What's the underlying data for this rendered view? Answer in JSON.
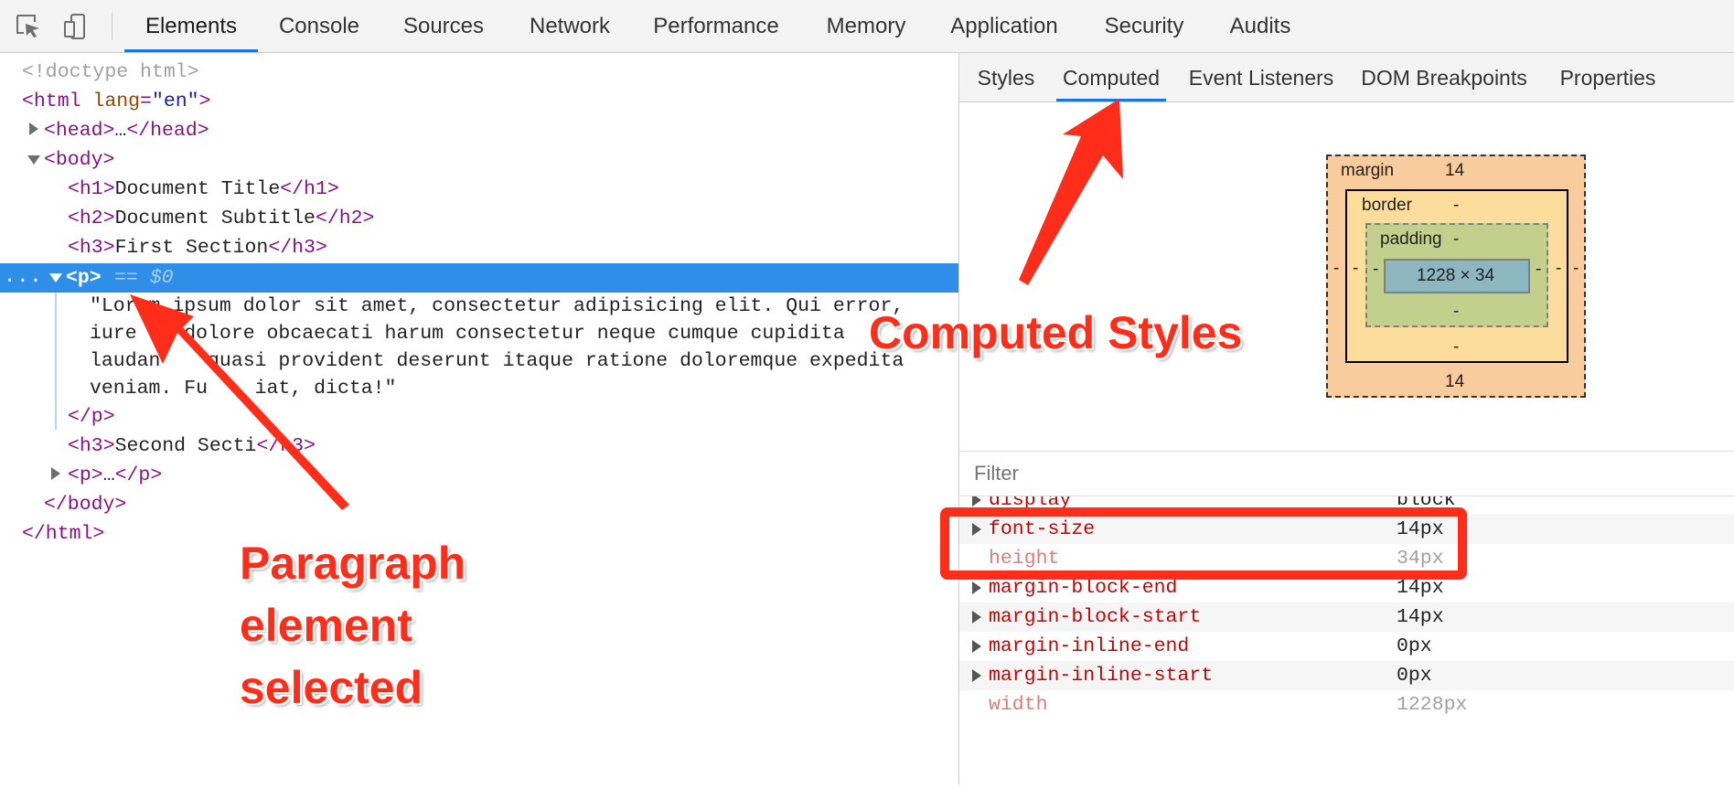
{
  "toolbar": {
    "icons": [
      "inspect-element-icon",
      "device-toolbar-icon"
    ],
    "tabs": [
      "Elements",
      "Console",
      "Sources",
      "Network",
      "Performance",
      "Memory",
      "Application",
      "Security",
      "Audits"
    ],
    "active_tab": "Elements"
  },
  "elements": {
    "doctype": "<!doctype html>",
    "html_open": "<html",
    "html_attr_name": "lang",
    "html_attr_value": "\"en\"",
    "head_tag_open": "<head>",
    "ellipsis": "…",
    "head_tag_close": "</head>",
    "body_open": "<body>",
    "h1_open": "<h1>",
    "h1_text": "Document Title",
    "h1_close": "</h1>",
    "h2_open": "<h2>",
    "h2_text": "Document Subtitle",
    "h2_close": "</h2>",
    "h3_open": "<h3>",
    "h3a_text": "First Section",
    "h3_close": "</h3>",
    "selected_dots": "...",
    "selected_tag": "<p>",
    "selected_marker": "== $0",
    "para_lines": [
      "\"Lorem ipsum dolor sit amet, consectetur adipisicing elit. Qui error,",
      "iure    dolore obcaecati harum consectetur neque cumque cupidita",
      "laudan    quasi provident deserunt itaque ratione doloremque expedita",
      "veniam. Fu    iat, dicta!\""
    ],
    "p_close": "</p>",
    "h3b_text": "Second Secti",
    "h3b_close": "</h3>",
    "p2_open": "<p>",
    "p2_close": "</p>",
    "body_close": "</body>",
    "html_close": "</html>"
  },
  "sidebar": {
    "tabs": [
      "Styles",
      "Computed",
      "Event Listeners",
      "DOM Breakpoints",
      "Properties"
    ],
    "active_tab": "Computed",
    "box_model": {
      "margin_label": "margin",
      "margin_top": "14",
      "margin_bottom": "14",
      "margin_left": "-",
      "margin_right": "-",
      "border_label": "border",
      "border_top": "-",
      "border_bottom": "-",
      "border_left": "-",
      "border_right": "-",
      "padding_label": "padding",
      "padding_top": "-",
      "padding_bottom": "-",
      "padding_left": "-",
      "padding_right": "-",
      "content": "1228 × 34"
    },
    "filter_placeholder": "Filter",
    "properties": [
      {
        "name": "display",
        "value": "block"
      },
      {
        "name": "font-size",
        "value": "14px"
      },
      {
        "name": "height",
        "value": "34px"
      },
      {
        "name": "margin-block-end",
        "value": "14px"
      },
      {
        "name": "margin-block-start",
        "value": "14px"
      },
      {
        "name": "margin-inline-end",
        "value": "0px"
      },
      {
        "name": "margin-inline-start",
        "value": "0px"
      },
      {
        "name": "width",
        "value": "1228px"
      }
    ]
  },
  "annotations": {
    "computed_styles": "Computed Styles",
    "paragraph_lines": [
      "Paragraph",
      "element",
      "selected"
    ],
    "color": "#ff2d1a"
  }
}
